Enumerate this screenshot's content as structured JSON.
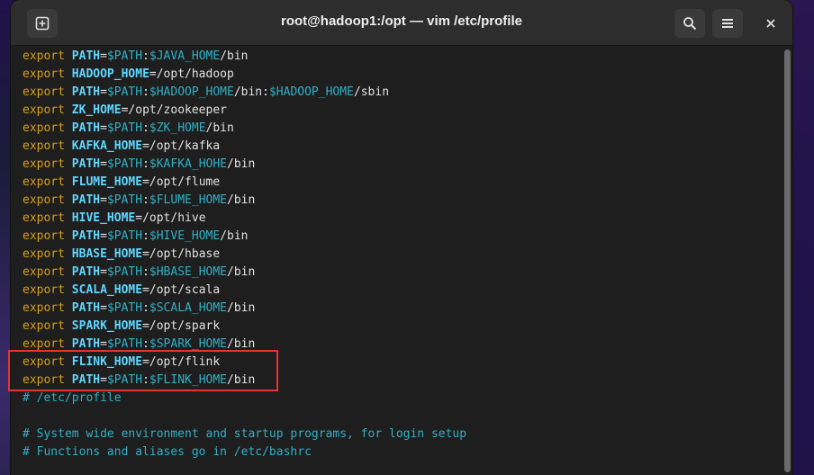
{
  "window": {
    "title": "root@hadoop1:/opt — vim /etc/profile"
  },
  "icons": {
    "new_tab": "new-tab-icon",
    "search": "search-icon",
    "menu": "hamburger-menu-icon",
    "close": "close-icon"
  },
  "colors": {
    "keyword": "#d7a019",
    "variable": "#5fd7ff",
    "reference": "#2fb0c8",
    "comment": "#2fb0c8",
    "highlight": "#e8342f"
  },
  "lines": [
    [
      {
        "c": "kw",
        "t": "export"
      },
      {
        "c": "plain",
        "t": " "
      },
      {
        "c": "var",
        "t": "PATH"
      },
      {
        "c": "plain",
        "t": "="
      },
      {
        "c": "ref",
        "t": "$PATH"
      },
      {
        "c": "plain",
        "t": ":"
      },
      {
        "c": "ref",
        "t": "$JAVA_HOME"
      },
      {
        "c": "plain",
        "t": "/bin"
      }
    ],
    [
      {
        "c": "kw",
        "t": "export"
      },
      {
        "c": "plain",
        "t": " "
      },
      {
        "c": "var",
        "t": "HADOOP_HOME"
      },
      {
        "c": "plain",
        "t": "=/opt/hadoop"
      }
    ],
    [
      {
        "c": "kw",
        "t": "export"
      },
      {
        "c": "plain",
        "t": " "
      },
      {
        "c": "var",
        "t": "PATH"
      },
      {
        "c": "plain",
        "t": "="
      },
      {
        "c": "ref",
        "t": "$PATH"
      },
      {
        "c": "plain",
        "t": ":"
      },
      {
        "c": "ref",
        "t": "$HADOOP_HOME"
      },
      {
        "c": "plain",
        "t": "/bin:"
      },
      {
        "c": "ref",
        "t": "$HADOOP_HOME"
      },
      {
        "c": "plain",
        "t": "/sbin"
      }
    ],
    [
      {
        "c": "kw",
        "t": "export"
      },
      {
        "c": "plain",
        "t": " "
      },
      {
        "c": "var",
        "t": "ZK_HOME"
      },
      {
        "c": "plain",
        "t": "=/opt/zookeeper"
      }
    ],
    [
      {
        "c": "kw",
        "t": "export"
      },
      {
        "c": "plain",
        "t": " "
      },
      {
        "c": "var",
        "t": "PATH"
      },
      {
        "c": "plain",
        "t": "="
      },
      {
        "c": "ref",
        "t": "$PATH"
      },
      {
        "c": "plain",
        "t": ":"
      },
      {
        "c": "ref",
        "t": "$ZK_HOME"
      },
      {
        "c": "plain",
        "t": "/bin"
      }
    ],
    [
      {
        "c": "kw",
        "t": "export"
      },
      {
        "c": "plain",
        "t": " "
      },
      {
        "c": "var",
        "t": "KAFKA_HOME"
      },
      {
        "c": "plain",
        "t": "=/opt/kafka"
      }
    ],
    [
      {
        "c": "kw",
        "t": "export"
      },
      {
        "c": "plain",
        "t": " "
      },
      {
        "c": "var",
        "t": "PATH"
      },
      {
        "c": "plain",
        "t": "="
      },
      {
        "c": "ref",
        "t": "$PATH"
      },
      {
        "c": "plain",
        "t": ":"
      },
      {
        "c": "ref",
        "t": "$KAFKA_HOHE"
      },
      {
        "c": "plain",
        "t": "/bin"
      }
    ],
    [
      {
        "c": "kw",
        "t": "export"
      },
      {
        "c": "plain",
        "t": " "
      },
      {
        "c": "var",
        "t": "FLUME_HOME"
      },
      {
        "c": "plain",
        "t": "=/opt/flume"
      }
    ],
    [
      {
        "c": "kw",
        "t": "export"
      },
      {
        "c": "plain",
        "t": " "
      },
      {
        "c": "var",
        "t": "PATH"
      },
      {
        "c": "plain",
        "t": "="
      },
      {
        "c": "ref",
        "t": "$PATH"
      },
      {
        "c": "plain",
        "t": ":"
      },
      {
        "c": "ref",
        "t": "$FLUME_HOME"
      },
      {
        "c": "plain",
        "t": "/bin"
      }
    ],
    [
      {
        "c": "kw",
        "t": "export"
      },
      {
        "c": "plain",
        "t": " "
      },
      {
        "c": "var",
        "t": "HIVE_HOME"
      },
      {
        "c": "plain",
        "t": "=/opt/hive"
      }
    ],
    [
      {
        "c": "kw",
        "t": "export"
      },
      {
        "c": "plain",
        "t": " "
      },
      {
        "c": "var",
        "t": "PATH"
      },
      {
        "c": "plain",
        "t": "="
      },
      {
        "c": "ref",
        "t": "$PATH"
      },
      {
        "c": "plain",
        "t": ":"
      },
      {
        "c": "ref",
        "t": "$HIVE_HOME"
      },
      {
        "c": "plain",
        "t": "/bin"
      }
    ],
    [
      {
        "c": "kw",
        "t": "export"
      },
      {
        "c": "plain",
        "t": " "
      },
      {
        "c": "var",
        "t": "HBASE_HOME"
      },
      {
        "c": "plain",
        "t": "=/opt/hbase"
      }
    ],
    [
      {
        "c": "kw",
        "t": "export"
      },
      {
        "c": "plain",
        "t": " "
      },
      {
        "c": "var",
        "t": "PATH"
      },
      {
        "c": "plain",
        "t": "="
      },
      {
        "c": "ref",
        "t": "$PATH"
      },
      {
        "c": "plain",
        "t": ":"
      },
      {
        "c": "ref",
        "t": "$HBASE_HOME"
      },
      {
        "c": "plain",
        "t": "/bin"
      }
    ],
    [
      {
        "c": "kw",
        "t": "export"
      },
      {
        "c": "plain",
        "t": " "
      },
      {
        "c": "var",
        "t": "SCALA_HOME"
      },
      {
        "c": "plain",
        "t": "=/opt/scala"
      }
    ],
    [
      {
        "c": "kw",
        "t": "export"
      },
      {
        "c": "plain",
        "t": " "
      },
      {
        "c": "var",
        "t": "PATH"
      },
      {
        "c": "plain",
        "t": "="
      },
      {
        "c": "ref",
        "t": "$PATH"
      },
      {
        "c": "plain",
        "t": ":"
      },
      {
        "c": "ref",
        "t": "$SCALA_HOME"
      },
      {
        "c": "plain",
        "t": "/bin"
      }
    ],
    [
      {
        "c": "kw",
        "t": "export"
      },
      {
        "c": "plain",
        "t": " "
      },
      {
        "c": "var",
        "t": "SPARK_HOME"
      },
      {
        "c": "plain",
        "t": "=/opt/spark"
      }
    ],
    [
      {
        "c": "kw",
        "t": "export"
      },
      {
        "c": "plain",
        "t": " "
      },
      {
        "c": "var",
        "t": "PATH"
      },
      {
        "c": "plain",
        "t": "="
      },
      {
        "c": "ref",
        "t": "$PATH"
      },
      {
        "c": "plain",
        "t": ":"
      },
      {
        "c": "ref",
        "t": "$SPARK_HOME"
      },
      {
        "c": "plain",
        "t": "/bin"
      }
    ],
    [
      {
        "c": "kw",
        "t": "export"
      },
      {
        "c": "plain",
        "t": " "
      },
      {
        "c": "var",
        "t": "FLINK_HOME"
      },
      {
        "c": "plain",
        "t": "=/opt/flink"
      }
    ],
    [
      {
        "c": "kw",
        "t": "export"
      },
      {
        "c": "plain",
        "t": " "
      },
      {
        "c": "var",
        "t": "PATH"
      },
      {
        "c": "plain",
        "t": "="
      },
      {
        "c": "ref",
        "t": "$PATH"
      },
      {
        "c": "plain",
        "t": ":"
      },
      {
        "c": "ref",
        "t": "$FLINK_HOME"
      },
      {
        "c": "plain",
        "t": "/bin"
      }
    ],
    [
      {
        "c": "comment",
        "t": "# /etc/profile"
      }
    ],
    [
      {
        "c": "plain",
        "t": ""
      }
    ],
    [
      {
        "c": "comment",
        "t": "# System wide environment and startup programs, for login setup"
      }
    ],
    [
      {
        "c": "comment",
        "t": "# Functions and aliases go in /etc/bashrc"
      }
    ]
  ]
}
